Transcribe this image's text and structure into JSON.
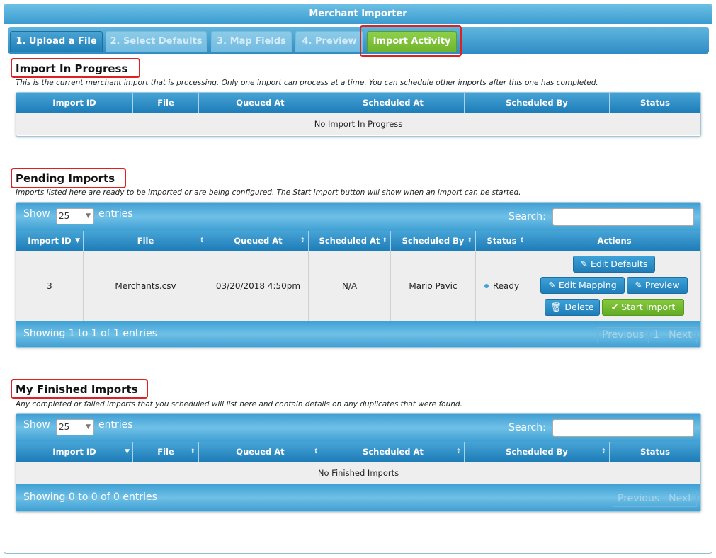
{
  "window": {
    "title": "Merchant Importer"
  },
  "tabs": [
    {
      "label": "1. Upload a File",
      "state": "active"
    },
    {
      "label": "2. Select Defaults",
      "state": "disabled"
    },
    {
      "label": "3. Map Fields",
      "state": "disabled"
    },
    {
      "label": "4. Preview",
      "state": "disabled"
    },
    {
      "label": "Import Activity",
      "state": "current"
    }
  ],
  "in_progress": {
    "title": "Import In Progress",
    "description": "This is the current merchant import that is processing. Only one import can process at a time. You can schedule other imports after this one has completed.",
    "columns": [
      "Import ID",
      "File",
      "Queued At",
      "Scheduled At",
      "Scheduled By",
      "Status"
    ],
    "empty_message": "No Import In Progress"
  },
  "pending": {
    "title": "Pending Imports",
    "description": "Imports listed here are ready to be imported or are being configured. The Start Import button will show when an import can be started.",
    "show_label": "Show",
    "page_size": "25",
    "entries_label": "entries",
    "search_label": "Search:",
    "columns": [
      "Import ID",
      "File",
      "Queued At",
      "Scheduled At",
      "Scheduled By",
      "Status",
      "Actions"
    ],
    "rows": [
      {
        "import_id": "3",
        "file": "Merchants.csv",
        "queued_at": "03/20/2018 4:50pm",
        "scheduled_at": "N/A",
        "scheduled_by": "Mario Pavic",
        "status": "Ready"
      }
    ],
    "actions": {
      "edit_defaults": "Edit Defaults",
      "edit_mapping": "Edit Mapping",
      "preview": "Preview",
      "delete": "Delete",
      "start_import": "Start Import"
    },
    "showing": "Showing 1 to 1 of 1 entries",
    "pager": {
      "previous": "Previous",
      "page": "1",
      "next": "Next"
    }
  },
  "finished": {
    "title": "My Finished Imports",
    "description": "Any completed or failed imports that you scheduled will list here and contain details on any duplicates that were found.",
    "show_label": "Show",
    "page_size": "25",
    "entries_label": "entries",
    "search_label": "Search:",
    "columns": [
      "Import ID",
      "File",
      "Queued At",
      "Scheduled At",
      "Scheduled By",
      "Status"
    ],
    "empty_message": "No Finished Imports",
    "showing": "Showing 0 to 0 of 0 entries",
    "pager": {
      "previous": "Previous",
      "next": "Next"
    }
  },
  "colors": {
    "accent_blue": "#1f7db8",
    "green": "#6fb52c",
    "highlight_red": "#e02020"
  },
  "icons": {
    "edit": "pencil-icon",
    "delete": "trash-icon",
    "start": "check-icon",
    "sort": "sort-arrows-icon",
    "dropdown": "chevron-down-icon"
  }
}
